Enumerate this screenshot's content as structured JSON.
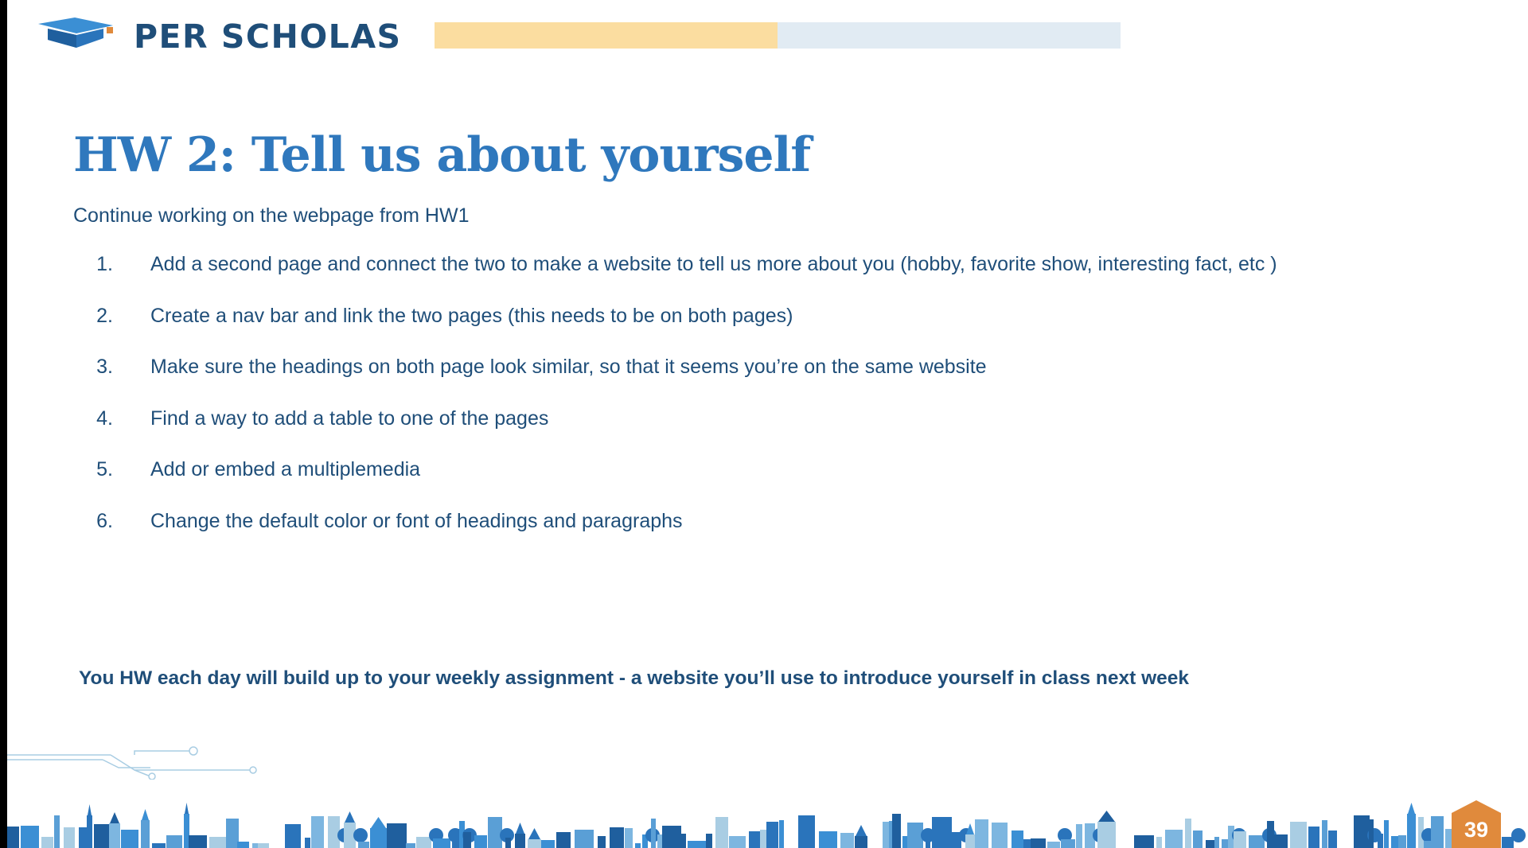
{
  "brand": {
    "name": "PER SCHOLAS",
    "logo_icon": "graduation-cap-icon"
  },
  "header": {
    "progress_fraction": 0.5
  },
  "slide": {
    "title": "HW 2: Tell us about yourself",
    "subtitle": "Continue working on the webpage from HW1",
    "steps": [
      {
        "num": "1.",
        "text": "Add a second page and connect the two to make a website to tell us more about you (hobby, favorite show, interesting fact, etc )"
      },
      {
        "num": "2.",
        "text": "Create a nav bar and link the two pages (this needs to be on both pages)"
      },
      {
        "num": "3.",
        "text": "Make sure the headings on both page look similar, so that it seems you’re on the same website"
      },
      {
        "num": "4.",
        "text": "Find a way to add a table to one of the pages"
      },
      {
        "num": "5.",
        "text": "Add or embed a multiplemedia"
      },
      {
        "num": "6.",
        "text": "Change the default color or font of headings and paragraphs"
      }
    ],
    "note": "You HW each day will build up to your weekly assignment - a website you’ll use to introduce yourself in class next week",
    "page_number": "39"
  },
  "colors": {
    "title": "#2f78bd",
    "body_text": "#1f4e79",
    "progress_track": "#e1ebf3",
    "progress_fill": "#fbdda0",
    "badge": "#e08a3c"
  }
}
